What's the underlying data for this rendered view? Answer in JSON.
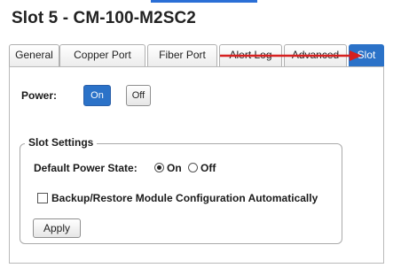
{
  "page": {
    "title": "Slot 5 - CM-100-M2SC2"
  },
  "tabs": [
    {
      "label": "General"
    },
    {
      "label": "Copper Port"
    },
    {
      "label": "Fiber Port"
    },
    {
      "label": "Alert Log"
    },
    {
      "label": "Advanced"
    },
    {
      "label": "Slot"
    }
  ],
  "power": {
    "label": "Power:",
    "on_label": "On",
    "off_label": "Off"
  },
  "slot_settings": {
    "legend": "Slot Settings",
    "default_power_state_label": "Default Power State:",
    "radio_on_label": "On",
    "radio_off_label": "Off",
    "selected": "On",
    "backup_label": "Backup/Restore Module Configuration Automatically",
    "backup_checked": false,
    "apply_label": "Apply"
  },
  "colors": {
    "accent": "#2b72c8",
    "arrow": "#d62020"
  }
}
